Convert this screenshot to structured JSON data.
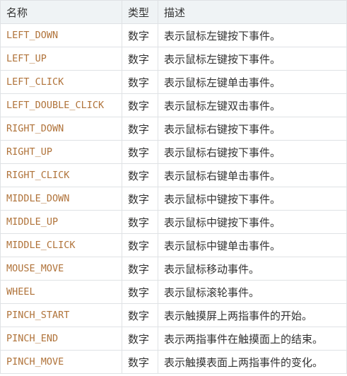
{
  "table": {
    "headers": [
      "名称",
      "类型",
      "描述"
    ],
    "rows": [
      {
        "name": "LEFT_DOWN",
        "type": "数字",
        "desc": "表示鼠标左键按下事件。"
      },
      {
        "name": "LEFT_UP",
        "type": "数字",
        "desc": "表示鼠标左键按下事件。"
      },
      {
        "name": "LEFT_CLICK",
        "type": "数字",
        "desc": "表示鼠标左键单击事件。"
      },
      {
        "name": "LEFT_DOUBLE_CLICK",
        "type": "数字",
        "desc": "表示鼠标左键双击事件。"
      },
      {
        "name": "RIGHT_DOWN",
        "type": "数字",
        "desc": "表示鼠标右键按下事件。"
      },
      {
        "name": "RIGHT_UP",
        "type": "数字",
        "desc": "表示鼠标右键按下事件。"
      },
      {
        "name": "RIGHT_CLICK",
        "type": "数字",
        "desc": "表示鼠标右键单击事件。"
      },
      {
        "name": "MIDDLE_DOWN",
        "type": "数字",
        "desc": "表示鼠标中键按下事件。"
      },
      {
        "name": "MIDDLE_UP",
        "type": "数字",
        "desc": "表示鼠标中键按下事件。"
      },
      {
        "name": "MIDDLE_CLICK",
        "type": "数字",
        "desc": "表示鼠标中键单击事件。"
      },
      {
        "name": "MOUSE_MOVE",
        "type": "数字",
        "desc": "表示鼠标移动事件。"
      },
      {
        "name": "WHEEL",
        "type": "数字",
        "desc": "表示鼠标滚轮事件。"
      },
      {
        "name": "PINCH_START",
        "type": "数字",
        "desc": "表示触摸屏上两指事件的开始。"
      },
      {
        "name": "PINCH_END",
        "type": "数字",
        "desc": "表示两指事件在触摸面上的结束。"
      },
      {
        "name": "PINCH_MOVE",
        "type": "数字",
        "desc": "表示触摸表面上两指事件的变化。"
      }
    ]
  },
  "colors": {
    "header_bg": "#eff3f5",
    "border": "#dfe2e5",
    "name_text": "#b0733a",
    "body_text": "#333333"
  }
}
